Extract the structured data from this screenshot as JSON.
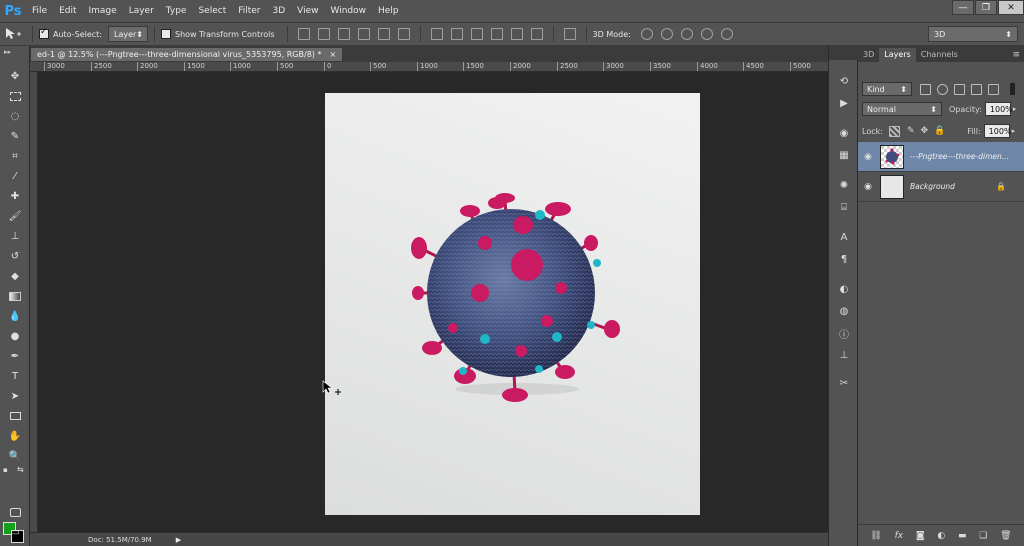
{
  "menubar": {
    "logo": "Ps",
    "items": [
      "File",
      "Edit",
      "Image",
      "Layer",
      "Type",
      "Select",
      "Filter",
      "3D",
      "View",
      "Window",
      "Help"
    ],
    "window_controls": [
      "—",
      "❐",
      "✕"
    ]
  },
  "options": {
    "auto_select_label": "Auto-Select:",
    "auto_select_value": "Layer",
    "show_transform_label": "Show Transform Controls",
    "mode_label": "3D Mode:",
    "workspace": "3D"
  },
  "document": {
    "tab_title": "ed-1 @ 12.5% (---Pngtree---three-dimensional virus_5353795, RGB/8) *",
    "tab_close": "×"
  },
  "ruler": {
    "h_ticks": [
      "3000",
      "2500",
      "2000",
      "1500",
      "1000",
      "500",
      "0",
      "500",
      "1000",
      "1500",
      "2000",
      "2500",
      "3000",
      "3500",
      "4000",
      "4500",
      "5000"
    ]
  },
  "status": {
    "doc": "Doc: 51.5M/70.9M",
    "arrow": "▶"
  },
  "panel": {
    "tabs": [
      "3D",
      "Layers",
      "Channels"
    ],
    "active_tab": "Layers",
    "filter_kind": "Kind",
    "blend_mode": "Normal",
    "opacity_label": "Opacity:",
    "opacity_value": "100%",
    "lock_label": "Lock:",
    "fill_label": "Fill:",
    "fill_value": "100%",
    "layers": [
      {
        "name": "---Pngtree---three-dimen...",
        "selected": true
      },
      {
        "name": "Background",
        "selected": false
      }
    ]
  },
  "colors": {
    "foreground": "#14a01a",
    "background": "#000000",
    "accent": "#31a8ff"
  }
}
